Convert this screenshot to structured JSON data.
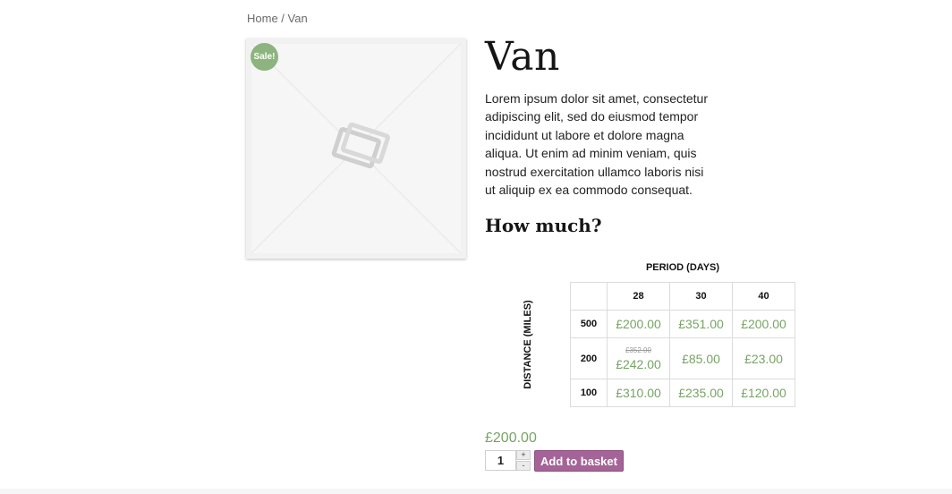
{
  "breadcrumb": {
    "home": "Home",
    "separator": " / ",
    "current": "Van"
  },
  "product": {
    "sale_badge": "Sale!",
    "placeholder_icon": "image-placeholder-icon",
    "title": "Van",
    "description": "Lorem ipsum dolor sit amet, consectetur adipiscing elit, sed do eiusmod tempor incididunt ut labore et dolore magna aliqua. Ut enim ad minim veniam, quis nostrud exercitation ullamco laboris nisi ut aliquip ex ea commodo consequat.",
    "how_much_heading": "How much?",
    "price": "£200.00"
  },
  "pricing_table": {
    "period_label": "PERIOD (DAYS)",
    "distance_label": "DISTANCE (MILES)",
    "periods": [
      "28",
      "30",
      "40"
    ],
    "rows": [
      {
        "distance": "500",
        "cells": [
          {
            "old": "",
            "price": "£200.00"
          },
          {
            "old": "",
            "price": "£351.00"
          },
          {
            "old": "",
            "price": "£200.00"
          }
        ]
      },
      {
        "distance": "200",
        "cells": [
          {
            "old": "£352.00",
            "price": "£242.00"
          },
          {
            "old": "",
            "price": "£85.00"
          },
          {
            "old": "",
            "price": "£23.00"
          }
        ]
      },
      {
        "distance": "100",
        "cells": [
          {
            "old": "",
            "price": "£310.00"
          },
          {
            "old": "",
            "price": "£235.00"
          },
          {
            "old": "",
            "price": "£120.00"
          }
        ]
      }
    ]
  },
  "cart": {
    "quantity": "1",
    "plus": "+",
    "minus": "-",
    "add_label": "Add to basket"
  },
  "colors": {
    "price_green": "#77a464",
    "sale_badge": "#8db47e",
    "button_purple": "#a46497"
  }
}
